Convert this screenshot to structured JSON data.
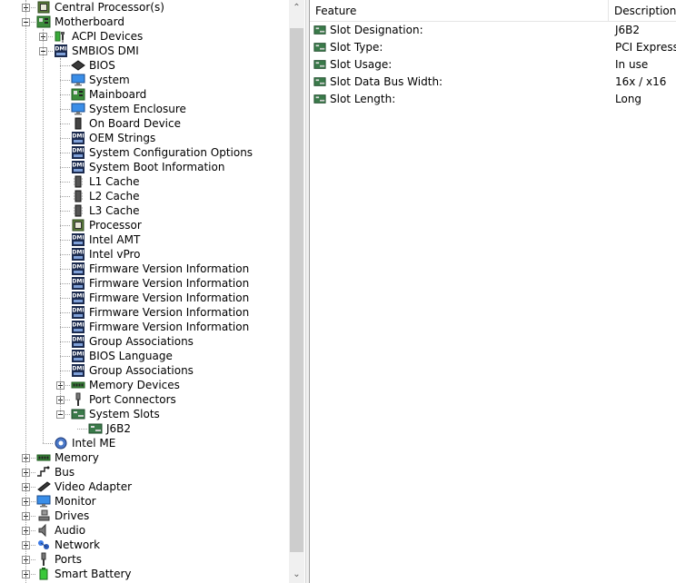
{
  "tree": [
    {
      "label": "Central Processor(s)",
      "level": 0,
      "expander": "plus",
      "icon": "cpu-icon"
    },
    {
      "label": "Motherboard",
      "level": 0,
      "expander": "minus",
      "icon": "motherboard-icon"
    },
    {
      "label": "ACPI Devices",
      "level": 1,
      "expander": "plus",
      "icon": "acpi-plug-icon"
    },
    {
      "label": "SMBIOS DMI",
      "level": 1,
      "expander": "minus",
      "icon": "dmi-icon"
    },
    {
      "label": "BIOS",
      "level": 2,
      "icon": "bios-chip-icon"
    },
    {
      "label": "System",
      "level": 2,
      "icon": "monitor-icon"
    },
    {
      "label": "Mainboard",
      "level": 2,
      "icon": "motherboard-icon"
    },
    {
      "label": "System Enclosure",
      "level": 2,
      "icon": "monitor-icon"
    },
    {
      "label": "On Board Device",
      "level": 2,
      "icon": "device-chip-icon"
    },
    {
      "label": "OEM Strings",
      "level": 2,
      "icon": "dmi-icon"
    },
    {
      "label": "System Configuration Options",
      "level": 2,
      "icon": "dmi-icon"
    },
    {
      "label": "System Boot Information",
      "level": 2,
      "icon": "dmi-icon"
    },
    {
      "label": "L1 Cache",
      "level": 2,
      "icon": "cache-chip-icon"
    },
    {
      "label": "L2 Cache",
      "level": 2,
      "icon": "cache-chip-icon"
    },
    {
      "label": "L3 Cache",
      "level": 2,
      "icon": "cache-chip-icon"
    },
    {
      "label": "Processor",
      "level": 2,
      "icon": "cpu-icon"
    },
    {
      "label": "Intel AMT",
      "level": 2,
      "icon": "dmi-icon"
    },
    {
      "label": "Intel vPro",
      "level": 2,
      "icon": "dmi-icon"
    },
    {
      "label": "Firmware Version Information",
      "level": 2,
      "icon": "dmi-icon"
    },
    {
      "label": "Firmware Version Information",
      "level": 2,
      "icon": "dmi-icon"
    },
    {
      "label": "Firmware Version Information",
      "level": 2,
      "icon": "dmi-icon"
    },
    {
      "label": "Firmware Version Information",
      "level": 2,
      "icon": "dmi-icon"
    },
    {
      "label": "Firmware Version Information",
      "level": 2,
      "icon": "dmi-icon"
    },
    {
      "label": "Group Associations",
      "level": 2,
      "icon": "dmi-icon"
    },
    {
      "label": "BIOS Language",
      "level": 2,
      "icon": "dmi-icon"
    },
    {
      "label": "Group Associations",
      "level": 2,
      "icon": "dmi-icon"
    },
    {
      "label": "Memory Devices",
      "level": 2,
      "expander": "plus",
      "icon": "memory-icon"
    },
    {
      "label": "Port Connectors",
      "level": 2,
      "expander": "plus",
      "icon": "port-icon"
    },
    {
      "label": "System Slots",
      "level": 2,
      "expander": "minus",
      "icon": "slot-icon"
    },
    {
      "label": "J6B2",
      "level": 3,
      "icon": "slot-icon",
      "selected": true
    },
    {
      "label": "Intel ME",
      "level": 1,
      "icon": "gear-icon"
    },
    {
      "label": "Memory",
      "level": 0,
      "expander": "plus",
      "icon": "memory-icon"
    },
    {
      "label": "Bus",
      "level": 0,
      "expander": "plus",
      "icon": "bus-icon"
    },
    {
      "label": "Video Adapter",
      "level": 0,
      "expander": "plus",
      "icon": "video-card-icon"
    },
    {
      "label": "Monitor",
      "level": 0,
      "expander": "plus",
      "icon": "monitor-icon"
    },
    {
      "label": "Drives",
      "level": 0,
      "expander": "plus",
      "icon": "drive-icon"
    },
    {
      "label": "Audio",
      "level": 0,
      "expander": "plus",
      "icon": "speaker-icon"
    },
    {
      "label": "Network",
      "level": 0,
      "expander": "plus",
      "icon": "network-icon"
    },
    {
      "label": "Ports",
      "level": 0,
      "expander": "plus",
      "icon": "port-icon"
    },
    {
      "label": "Smart Battery",
      "level": 0,
      "expander": "plus",
      "icon": "battery-icon"
    }
  ],
  "scrollbar": {
    "up_glyph": "⌃",
    "down_glyph": "⌄"
  },
  "details": {
    "columns": {
      "feature": "Feature",
      "description": "Description"
    },
    "rows": [
      {
        "feature": "Slot Designation:",
        "value": "J6B2",
        "icon": "slot-icon"
      },
      {
        "feature": "Slot Type:",
        "value": "PCI Express",
        "icon": "slot-icon"
      },
      {
        "feature": "Slot Usage:",
        "value": "In use",
        "icon": "slot-icon"
      },
      {
        "feature": "Slot Data Bus Width:",
        "value": "16x / x16",
        "icon": "slot-icon"
      },
      {
        "feature": "Slot Length:",
        "value": "Long",
        "icon": "slot-icon"
      }
    ]
  }
}
